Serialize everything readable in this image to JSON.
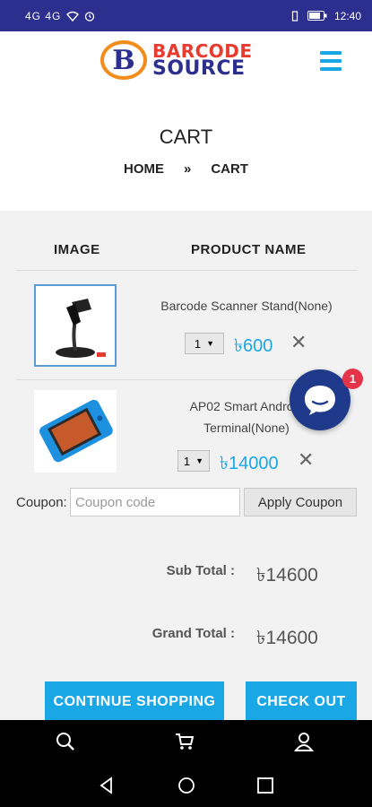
{
  "status_bar": {
    "signal": "4G 4G",
    "time": "12:40"
  },
  "header": {
    "logo_letter": "B",
    "logo_line1": "BARCODE",
    "logo_line2": "SOURCE"
  },
  "page": {
    "title": "CART",
    "breadcrumb": {
      "home": "HOME",
      "separator": "»",
      "current": "CART"
    }
  },
  "cart": {
    "columns": {
      "image": "IMAGE",
      "product_name": "PRODUCT NAME"
    },
    "items": [
      {
        "name": "Barcode Scanner Stand(None)",
        "qty": "1",
        "price": "৳600",
        "remove": "✕"
      },
      {
        "name_line1": "AP02 Smart Android",
        "name_line2": "Terminal(None)",
        "qty": "1",
        "price": "৳14000",
        "remove": "✕"
      }
    ]
  },
  "coupon": {
    "label": "Coupon:",
    "placeholder": "Coupon code",
    "button": "Apply Coupon"
  },
  "totals": {
    "sub_total_label": "Sub Total :",
    "sub_total_value": "৳14600",
    "grand_total_label": "Grand Total :",
    "grand_total_value": "৳14600"
  },
  "actions": {
    "continue_shopping": "CONTINUE SHOPPING",
    "check_out": "CHECK OUT"
  },
  "chat": {
    "badge_count": "1"
  },
  "colors": {
    "status_bar": "#2d2f8f",
    "accent": "#1aa7e6",
    "logo_red": "#e63b2e",
    "logo_blue": "#2d2f8f",
    "logo_orange": "#f28c1b",
    "chat_bg": "#1f3a8a",
    "badge": "#e5344a"
  },
  "icons": {
    "nav": [
      "search-icon",
      "cart-icon",
      "user-icon"
    ],
    "system": [
      "back-icon",
      "home-icon",
      "recents-icon"
    ]
  }
}
